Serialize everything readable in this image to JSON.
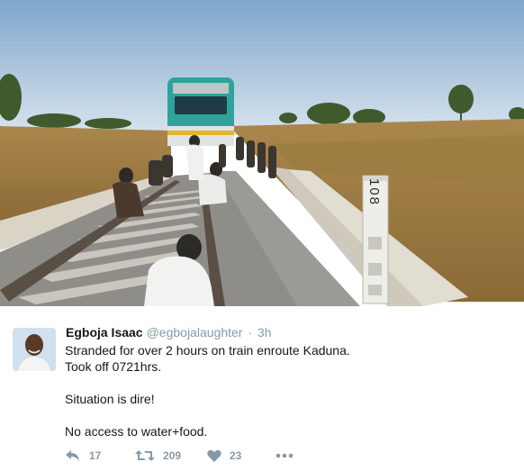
{
  "photo": {
    "milepost_label": "108"
  },
  "tweet": {
    "author_name": "Egboja Isaac",
    "handle": "@egbojalaughter",
    "separator": "·",
    "time": "3h",
    "lines": [
      "Stranded for over 2 hours on train enroute Kaduna.",
      "Took off 0721hrs.",
      "",
      "Situation is dire!",
      "",
      "No access to water+food."
    ],
    "actions": {
      "reply_count": "17",
      "retweet_count": "209",
      "like_count": "23"
    }
  },
  "icons": {
    "reply": "reply-icon",
    "retweet": "retweet-icon",
    "like": "heart-icon",
    "more": "more-icon"
  },
  "colors": {
    "icon_gray": "#8899a6",
    "text_dark": "#14171a",
    "train_teal": "#2fa39b"
  }
}
